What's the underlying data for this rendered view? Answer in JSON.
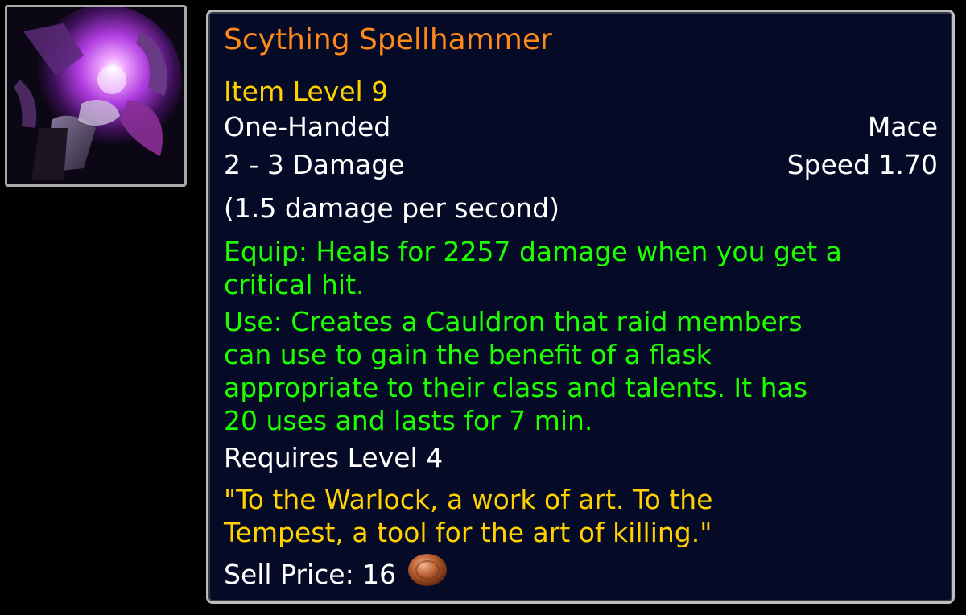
{
  "item": {
    "icon": "purple-glowing-spellhammer-mace-icon",
    "name": "Scything Spellhammer",
    "item_level": "Item Level 9",
    "slot": "One-Handed",
    "type": "Mace",
    "damage": "2 - 3 Damage",
    "speed": "Speed 1.70",
    "dps": "(1.5 damage per second)",
    "equip_lines": [
      "Equip: Heals for 2257 damage when you get a",
      "critical hit."
    ],
    "use_lines": [
      "Use: Creates a Cauldron that raid members",
      "can use to gain the benefit of a flask",
      "appropriate to their class and talents. It has",
      "20 uses and lasts for 7 min."
    ],
    "requires": "Requires Level 4",
    "flavor_lines": [
      "\"To the Warlock, a work of art. To the",
      "Tempest, a tool for the art of killing.\""
    ],
    "sell_price_label": "Sell Price: 16",
    "coin_icon": "copper-coin-icon"
  },
  "colors": {
    "name_epic_orange": "#ff8a1a",
    "item_level_yellow": "#ffd100",
    "effect_green": "#1eff00",
    "flavor_gold": "#ffd100",
    "tooltip_background": "#050a26",
    "border_grey": "#bdbdbd"
  }
}
